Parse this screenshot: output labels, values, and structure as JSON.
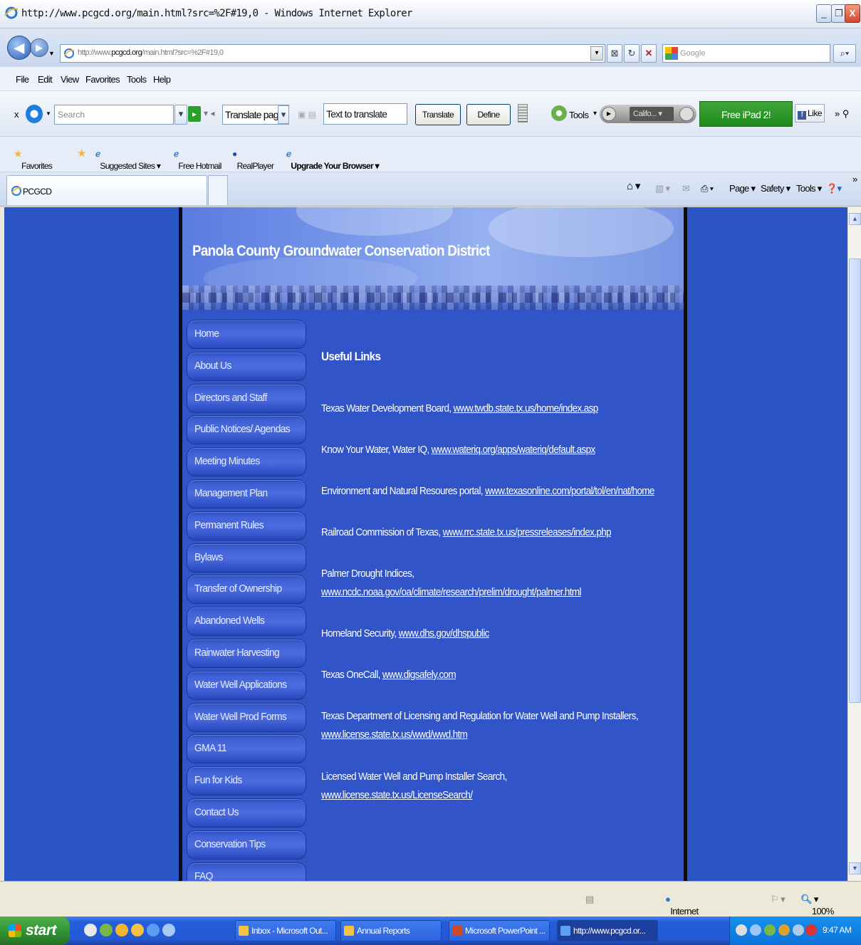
{
  "window": {
    "title": "http://www.pcgcd.org/main.html?src=%2F#19,0 - Windows Internet Explorer",
    "minimize": "_",
    "restore": "❐",
    "close": "X"
  },
  "address": {
    "url_prefix": "http://www.",
    "url_domain": "pcgcd.org",
    "url_suffix": "/main.html?src=%2F#19,0",
    "search_placeholder": "Google"
  },
  "menu": {
    "items": [
      "File",
      "Edit",
      "View",
      "Favorites",
      "Tools",
      "Help"
    ]
  },
  "toolbar": {
    "search_placeholder": "Search",
    "translate_select": "Translate pag",
    "text_to_translate": "Text to translate",
    "translate_button": "Translate",
    "define_button": "Define",
    "tools_label": "Tools",
    "radio_station": "Califo...",
    "ipad_button": "Free iPad 2!",
    "like_button": "Like"
  },
  "favorites_bar": {
    "favorites": "Favorites",
    "suggested_sites": "Suggested Sites ▾",
    "free_hotmail": "Free Hotmail",
    "realplayer": "RealPlayer",
    "upgrade": "Upgrade Your Browser ▾"
  },
  "tabs": {
    "active_tab": "PCGCD",
    "page_menu": "Page ▾",
    "safety_menu": "Safety ▾",
    "tools_menu": "Tools ▾"
  },
  "site": {
    "title": "Panola County Groundwater Conservation District",
    "nav": [
      "Home",
      "About Us",
      "Directors and Staff",
      "Public Notices/ Agendas",
      "Meeting Minutes",
      "Management Plan",
      "Permanent Rules",
      "Bylaws",
      "Transfer of Ownership",
      "Abandoned Wells",
      "Rainwater Harvesting",
      "Water Well Applications",
      "Water Well Prod Forms",
      "GMA 11",
      "Fun for Kids",
      "Contact Us",
      "Conservation Tips",
      "FAQ"
    ],
    "heading": "Useful Links",
    "links": [
      {
        "label": "Texas Water Development Board, ",
        "url": "www.twdb.state.tx.us/home/index.asp"
      },
      {
        "label": "Know Your Water, Water IQ,  ",
        "url": "www.wateriq.org/apps/wateriq/default.aspx"
      },
      {
        "label": "Environment and Natural Resoures portal, ",
        "url": "www.texasonline.com/portal/tol/en/nat/home"
      },
      {
        "label": "Railroad Commission of Texas, ",
        "url": "www.rrc.state.tx.us/pressreleases/index.php"
      },
      {
        "label": "Palmer Drought Indices,",
        "url": "www.ncdc.noaa.gov/oa/climate/research/prelim/drought/palmer.html"
      },
      {
        "label": "Homeland Security,  ",
        "url": "www.dhs.gov/dhspublic"
      },
      {
        "label": "Texas OneCall, ",
        "url": "www.digsafely.com"
      },
      {
        "label": "Texas Department of Licensing and Regulation for Water Well and Pump Installers,",
        "url": "www.license.state.tx.us/wwd/wwd.htm"
      },
      {
        "label": "Licensed Water Well and Pump Installer Search,",
        "url": "www.license.state.tx.us/LicenseSearch/"
      }
    ]
  },
  "status": {
    "zone": "Internet",
    "zoom": "100%"
  },
  "taskbar": {
    "start": "start",
    "tasks": [
      "Inbox - Microsoft Out...",
      "Annual Reports",
      "Microsoft PowerPoint ...",
      "http://www.pcgcd.or..."
    ],
    "time": "9:47 AM"
  }
}
